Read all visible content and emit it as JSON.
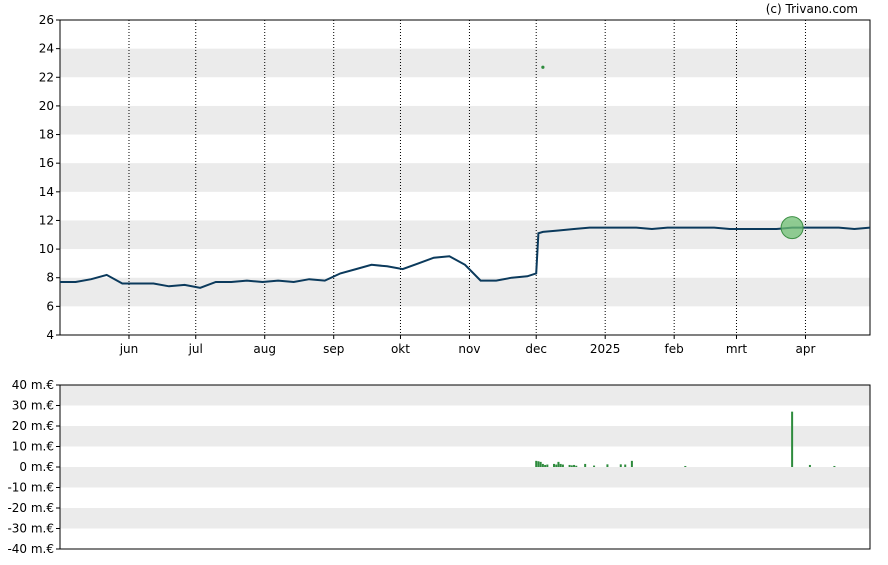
{
  "attribution": "(c) Trivano.com",
  "colors": {
    "price_line": "#0b3a5c",
    "volume_bar": "#2e8b3d",
    "marker_fill": "#6fbf73",
    "band": "#ebebeb",
    "grid": "#000000"
  },
  "chart_data": [
    {
      "type": "line",
      "title": "",
      "xlabel": "",
      "ylabel": "",
      "ylim": [
        4,
        26
      ],
      "yticks": [
        "4",
        "6",
        "8",
        "10",
        "12",
        "14",
        "16",
        "18",
        "20",
        "22",
        "24",
        "26"
      ],
      "month_labels": [
        "jun",
        "jul",
        "aug",
        "sep",
        "okt",
        "nov",
        "dec",
        "2025",
        "feb",
        "mrt",
        "apr"
      ],
      "x": [
        "2024-05-01",
        "2024-05-08",
        "2024-05-15",
        "2024-05-22",
        "2024-05-29",
        "2024-06-05",
        "2024-06-12",
        "2024-06-19",
        "2024-06-26",
        "2024-07-03",
        "2024-07-10",
        "2024-07-17",
        "2024-07-24",
        "2024-07-31",
        "2024-08-07",
        "2024-08-14",
        "2024-08-21",
        "2024-08-28",
        "2024-09-04",
        "2024-09-11",
        "2024-09-18",
        "2024-09-25",
        "2024-10-02",
        "2024-10-09",
        "2024-10-16",
        "2024-10-23",
        "2024-10-30",
        "2024-11-06",
        "2024-11-13",
        "2024-11-20",
        "2024-11-27",
        "2024-12-01",
        "2024-12-02",
        "2024-12-04",
        "2024-12-11",
        "2024-12-18",
        "2024-12-25",
        "2025-01-01",
        "2025-01-08",
        "2025-01-15",
        "2025-01-22",
        "2025-01-29",
        "2025-02-05",
        "2025-02-12",
        "2025-02-19",
        "2025-02-26",
        "2025-03-05",
        "2025-03-12",
        "2025-03-19",
        "2025-03-26",
        "2025-04-02",
        "2025-04-09",
        "2025-04-16",
        "2025-04-23",
        "2025-04-30"
      ],
      "series": [
        {
          "values": [
            7.7,
            7.7,
            7.9,
            8.2,
            7.6,
            7.6,
            7.6,
            7.4,
            7.5,
            7.3,
            7.7,
            7.7,
            7.8,
            7.7,
            7.8,
            7.7,
            7.9,
            7.8,
            8.3,
            8.6,
            8.9,
            8.8,
            8.6,
            9.0,
            9.4,
            9.5,
            8.9,
            7.8,
            7.8,
            8.0,
            8.1,
            8.3,
            11.1,
            11.2,
            11.3,
            11.4,
            11.5,
            11.5,
            11.5,
            11.5,
            11.4,
            11.5,
            11.5,
            11.5,
            11.5,
            11.4,
            11.4,
            11.4,
            11.4,
            11.5,
            11.5,
            11.5,
            11.5,
            11.4,
            11.5
          ]
        }
      ],
      "scatter_points": [
        {
          "x": "2024-12-04",
          "y": 22.7
        }
      ],
      "highlight_point": {
        "x": "2025-03-26",
        "y": 11.5
      }
    },
    {
      "type": "bar",
      "title": "",
      "xlabel": "",
      "ylabel": "",
      "ylim": [
        -40,
        40
      ],
      "yticks": [
        "-40 m.€",
        "-30 m.€",
        "-20 m.€",
        "-10 m.€",
        "0 m.€",
        "10 m.€",
        "20 m.€",
        "30 m.€",
        "40 m.€"
      ],
      "x": [
        "2024-12-01",
        "2024-12-02",
        "2024-12-03",
        "2024-12-04",
        "2024-12-05",
        "2024-12-06",
        "2024-12-09",
        "2024-12-10",
        "2024-12-11",
        "2024-12-12",
        "2024-12-13",
        "2024-12-16",
        "2024-12-17",
        "2024-12-18",
        "2024-12-19",
        "2024-12-23",
        "2024-12-27",
        "2025-01-02",
        "2025-01-08",
        "2025-01-10",
        "2025-01-13",
        "2025-02-06",
        "2025-03-26",
        "2025-04-03",
        "2025-04-14"
      ],
      "values": [
        3.0,
        2.8,
        2.5,
        1.5,
        1.0,
        1.2,
        1.5,
        1.2,
        2.5,
        1.5,
        1.2,
        1.0,
        0.8,
        1.0,
        0.6,
        1.5,
        0.7,
        1.3,
        1.3,
        1.2,
        3.0,
        0.5,
        27.0,
        1.0,
        0.5
      ]
    }
  ]
}
